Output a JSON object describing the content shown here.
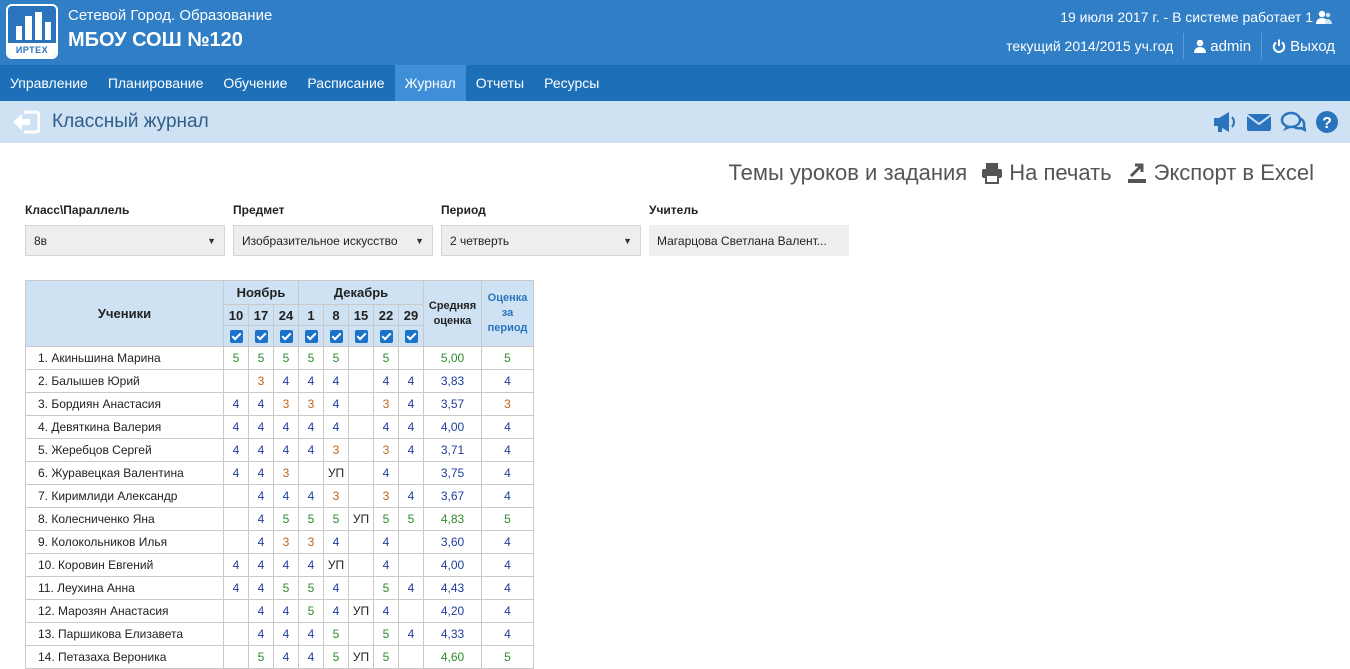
{
  "header": {
    "logo_text": "ИРТЕХ",
    "org_name": "Сетевой Город. Образование",
    "school_name": "МБОУ СОШ №120",
    "status": "19 июля 2017 г. - В системе работает 1",
    "academic_year": "текущий 2014/2015 уч.год",
    "user": "admin",
    "logout": "Выход"
  },
  "nav": [
    "Управление",
    "Планирование",
    "Обучение",
    "Расписание",
    "Журнал",
    "Отчеты",
    "Ресурсы"
  ],
  "nav_active": "Журнал",
  "page": {
    "title": "Классный журнал"
  },
  "actions": {
    "topics": "Темы уроков и задания",
    "print": "На печать",
    "export": "Экспорт в Excel"
  },
  "filters": {
    "class": {
      "label": "Класс\\Параллель",
      "value": "8в"
    },
    "subject": {
      "label": "Предмет",
      "value": "Изобразительное искусство"
    },
    "period": {
      "label": "Период",
      "value": "2 четверть"
    },
    "teacher": {
      "label": "Учитель",
      "value": "Магарцова Светлана Валент..."
    }
  },
  "table": {
    "students_header": "Ученики",
    "months": [
      {
        "name": "Ноябрь",
        "days": [
          "10",
          "17",
          "24"
        ]
      },
      {
        "name": "Декабрь",
        "days": [
          "1",
          "8",
          "15",
          "22",
          "29"
        ]
      }
    ],
    "avg_header": "Средняя оценка",
    "period_header": "Оценка за период",
    "rows": [
      {
        "name": "1. Акиньшина Марина",
        "marks": [
          "5",
          "5",
          "5",
          "5",
          "5",
          "",
          "5",
          ""
        ],
        "avg": "5,00",
        "period": "5"
      },
      {
        "name": "2. Балышев Юрий",
        "marks": [
          "",
          "3",
          "4",
          "4",
          "4",
          "",
          "4",
          "4"
        ],
        "avg": "3,83",
        "period": "4"
      },
      {
        "name": "3. Бордиян Анастасия",
        "marks": [
          "4",
          "4",
          "3",
          "3",
          "4",
          "",
          "3",
          "4"
        ],
        "avg": "3,57",
        "period": "3"
      },
      {
        "name": "4. Девяткина Валерия",
        "marks": [
          "4",
          "4",
          "4",
          "4",
          "4",
          "",
          "4",
          "4"
        ],
        "avg": "4,00",
        "period": "4"
      },
      {
        "name": "5. Жеребцов Сергей",
        "marks": [
          "4",
          "4",
          "4",
          "4",
          "3",
          "",
          "3",
          "4"
        ],
        "avg": "3,71",
        "period": "4"
      },
      {
        "name": "6. Журавецкая Валентина",
        "marks": [
          "4",
          "4",
          "3",
          "",
          "УП",
          "",
          "4",
          ""
        ],
        "avg": "3,75",
        "period": "4"
      },
      {
        "name": "7. Киримлиди Александр",
        "marks": [
          "",
          "4",
          "4",
          "4",
          "3",
          "",
          "3",
          "4"
        ],
        "avg": "3,67",
        "period": "4"
      },
      {
        "name": "8. Колесниченко Яна",
        "marks": [
          "",
          "4",
          "5",
          "5",
          "5",
          "УП",
          "5",
          "5"
        ],
        "avg": "4,83",
        "period": "5"
      },
      {
        "name": "9. Колокольников Илья",
        "marks": [
          "",
          "4",
          "3",
          "3",
          "4",
          "",
          "4",
          ""
        ],
        "avg": "3,60",
        "period": "4"
      },
      {
        "name": "10. Коровин Евгений",
        "marks": [
          "4",
          "4",
          "4",
          "4",
          "УП",
          "",
          "4",
          ""
        ],
        "avg": "4,00",
        "period": "4"
      },
      {
        "name": "11. Леухина Анна",
        "marks": [
          "4",
          "4",
          "5",
          "5",
          "4",
          "",
          "5",
          "4"
        ],
        "avg": "4,43",
        "period": "4"
      },
      {
        "name": "12. Марозян Анастасия",
        "marks": [
          "",
          "4",
          "4",
          "5",
          "4",
          "УП",
          "4",
          ""
        ],
        "avg": "4,20",
        "period": "4"
      },
      {
        "name": "13. Паршикова Елизавета",
        "marks": [
          "",
          "4",
          "4",
          "4",
          "5",
          "",
          "5",
          "4"
        ],
        "avg": "4,33",
        "period": "4"
      },
      {
        "name": "14. Петазаха Вероника",
        "marks": [
          "",
          "5",
          "4",
          "4",
          "5",
          "УП",
          "5",
          ""
        ],
        "avg": "4,60",
        "period": "5"
      }
    ]
  },
  "colors": {
    "header_bg": "#2f7ec6",
    "nav_bg": "#1d6fb8",
    "nav_active_bg": "#3e8fd8",
    "titlebar_bg": "#cfe2f3",
    "grade5": "#2e8b2e",
    "grade4": "#1f3c9c",
    "grade3": "#c0641a"
  }
}
